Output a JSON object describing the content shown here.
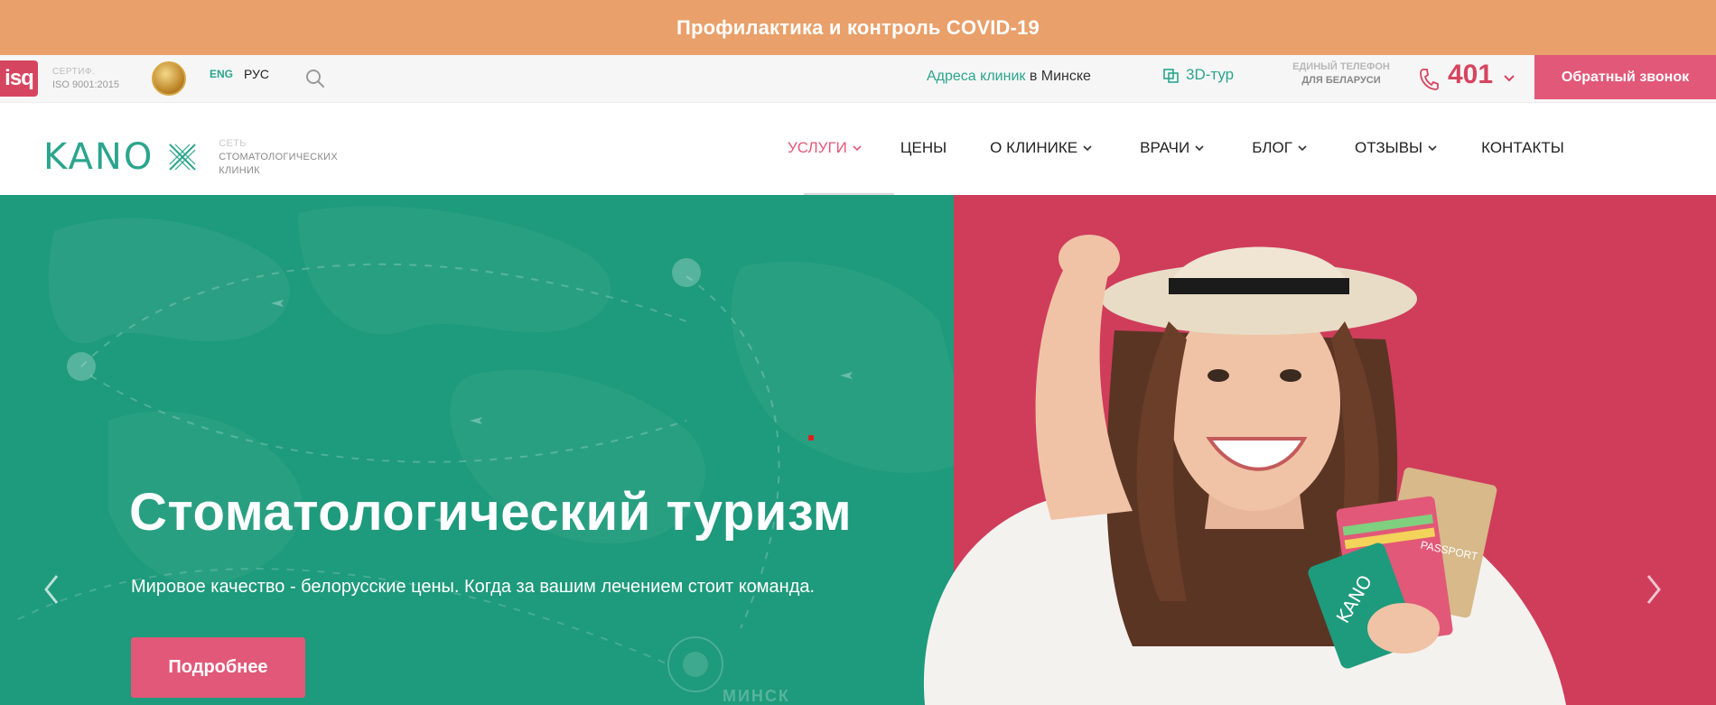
{
  "covid": {
    "label": "Профилактика и контроль COVID-19"
  },
  "utility": {
    "iso_badge": "isq",
    "iso_cert_top": "СЕРТИФ.",
    "iso_cert": "ISO 9001:2015",
    "lang_eng": "ENG",
    "lang_rus": "РУС",
    "address_link": "Адреса клиник",
    "address_city": " в Минске",
    "tour_label": "3D-тур",
    "phone_label_line1": "ЕДИНЫЙ ТЕЛЕФОН",
    "phone_label_line2": "ДЛЯ БЕЛАРУСИ",
    "phone_number": "401",
    "callback_label": "Обратный звонок",
    "colors": {
      "accent_pink": "#e25878",
      "brand_green": "#2ba58d"
    }
  },
  "header": {
    "logo_word": "KANO",
    "tagline_line1": "СЕТЬ",
    "tagline_line2": "СТОМАТОЛОГИЧЕСКИХ",
    "tagline_line3": "КЛИНИК",
    "nav": [
      {
        "label": "УСЛУГИ",
        "dropdown": true,
        "active": true
      },
      {
        "label": "ЦЕНЫ",
        "dropdown": false,
        "active": false
      },
      {
        "label": "О КЛИНИКЕ",
        "dropdown": true,
        "active": false
      },
      {
        "label": "ВРАЧИ",
        "dropdown": true,
        "active": false
      },
      {
        "label": "БЛОГ",
        "dropdown": true,
        "active": false
      },
      {
        "label": "ОТЗЫВЫ",
        "dropdown": true,
        "active": false
      },
      {
        "label": "КОНТАКТЫ",
        "dropdown": false,
        "active": false
      }
    ]
  },
  "hero": {
    "title": "Стоматологический туризм",
    "subtitle": "Мировое качество - белорусские цены. Когда за вашим лечением стоит команда.",
    "cta_label": "Подробнее",
    "map_label": "МИНСК",
    "card_brand": "KANO",
    "passport_label": "PASSPORT",
    "colors": {
      "left_bg": "#1e9a7c",
      "right_bg": "#cf3d5b"
    }
  }
}
